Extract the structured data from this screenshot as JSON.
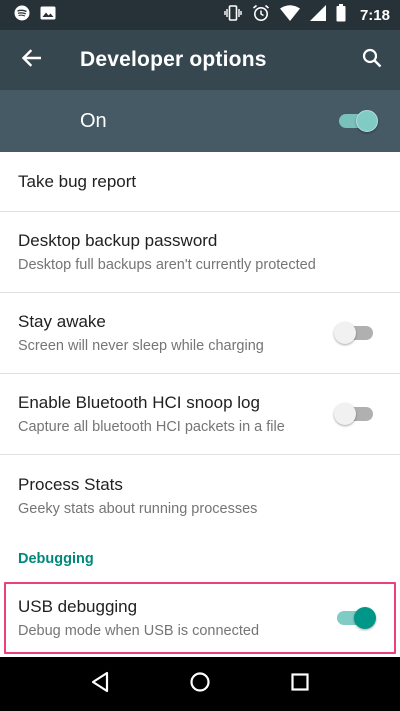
{
  "status_bar": {
    "time": "7:18",
    "icons": [
      "spotify-icon",
      "image-icon",
      "vibrate-icon",
      "alarm-icon",
      "wifi-icon",
      "signal-icon",
      "battery-icon"
    ]
  },
  "app_bar": {
    "title": "Developer options"
  },
  "master_switch": {
    "label": "On",
    "state": "on"
  },
  "items": [
    {
      "primary": "Take bug report"
    },
    {
      "primary": "Desktop backup password",
      "secondary": "Desktop full backups aren't currently protected"
    },
    {
      "primary": "Stay awake",
      "secondary": "Screen will never sleep while charging",
      "toggle": "off"
    },
    {
      "primary": "Enable Bluetooth HCI snoop log",
      "secondary": "Capture all bluetooth HCI packets in a file",
      "toggle": "off"
    },
    {
      "primary": "Process Stats",
      "secondary": "Geeky stats about running processes"
    }
  ],
  "debugging": {
    "header": "Debugging",
    "usb": {
      "primary": "USB debugging",
      "secondary": "Debug mode when USB is connected",
      "toggle": "on"
    }
  },
  "colors": {
    "status_bar": "#263238",
    "app_bar": "#37474f",
    "master_bar": "#455a64",
    "accent": "#009688",
    "section_header": "#00897b",
    "highlight_border": "#ec407a"
  }
}
